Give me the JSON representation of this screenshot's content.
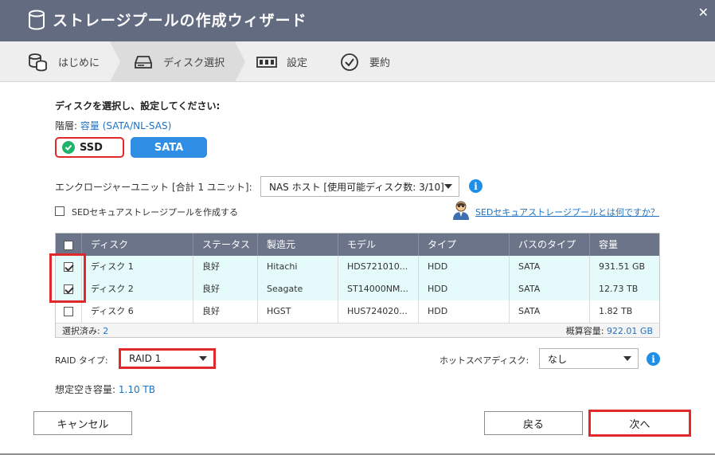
{
  "window": {
    "title": "ストレージプールの作成ウィザード",
    "close_glyph": "✕"
  },
  "steps": [
    {
      "label": "はじめに",
      "icon": "database-icon"
    },
    {
      "label": "ディスク選択",
      "icon": "disk-drive-icon",
      "active": true
    },
    {
      "label": "設定",
      "icon": "settings-icon"
    },
    {
      "label": "要約",
      "icon": "check-circle-icon"
    }
  ],
  "disk_select": {
    "heading": "ディスクを選択し、設定してください:",
    "tier_label": "階層:",
    "tier_value": "容量 (SATA/NL-SAS)",
    "tier_buttons": {
      "ssd": "SSD",
      "sata": "SATA"
    },
    "enclosure_label": "エンクロージャーユニット [合計 1 ユニット]:",
    "enclosure_value": "NAS ホスト [使用可能ディスク数: 3/10]",
    "sed_checkbox_label": "SEDセキュアストレージプールを作成する",
    "sed_link": "SEDセキュアストレージプールとは何ですか？"
  },
  "table": {
    "columns": [
      "ディスク",
      "ステータス",
      "製造元",
      "モデル",
      "タイプ",
      "バスのタイプ",
      "容量"
    ],
    "rows": [
      {
        "checked": true,
        "disk": "ディスク 1",
        "status": "良好",
        "vendor": "Hitachi",
        "model": "HDS721010...",
        "type": "HDD",
        "bus": "SATA",
        "capacity": "931.51 GB"
      },
      {
        "checked": true,
        "disk": "ディスク 2",
        "status": "良好",
        "vendor": "Seagate",
        "model": "ST14000NM...",
        "type": "HDD",
        "bus": "SATA",
        "capacity": "12.73 TB"
      },
      {
        "checked": false,
        "disk": "ディスク 6",
        "status": "良好",
        "vendor": "HGST",
        "model": "HUS724020...",
        "type": "HDD",
        "bus": "SATA",
        "capacity": "1.82 TB"
      }
    ],
    "footer_selected_label": "選択済み:",
    "footer_selected_value": "2",
    "footer_capacity_label": "概算容量:",
    "footer_capacity_value": "922.01 GB"
  },
  "raid": {
    "label": "RAID タイプ:",
    "value": "RAID 1"
  },
  "hot_spare": {
    "label": "ホットスペアディスク:",
    "value": "なし"
  },
  "capacity": {
    "label": "想定空き容量:",
    "value": "1.10 TB"
  },
  "buttons": {
    "cancel": "キャンセル",
    "back": "戻る",
    "next": "次へ"
  },
  "colors": {
    "title_bar": "#636b80",
    "table_header": "#6c748a",
    "accent_blue": "#2f8de4",
    "highlight_red": "#e02a2a",
    "selected_row": "#e5fbfb"
  }
}
